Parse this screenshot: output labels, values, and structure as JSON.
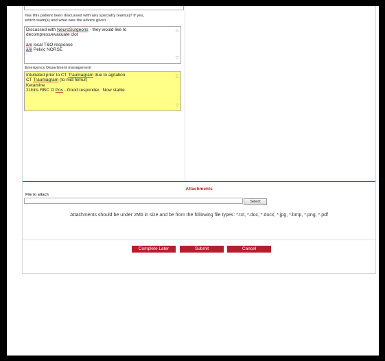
{
  "questions": {
    "specialty_label_1": "Has this patient been discussed with any specialty team(s)? If yes,",
    "specialty_label_2": "which team(s) and what was the advice given",
    "specialty_lines": [
      [
        "Discussed with ",
        "NeuroSurgeons",
        " - they would like to"
      ],
      [
        "decompress/evacuate clot",
        "",
        ""
      ],
      [
        "",
        "",
        ""
      ],
      [
        "",
        "a/e",
        " local T&O response"
      ],
      [
        "",
        "a/e",
        " Pelvic NORSE"
      ]
    ],
    "ed_label": "Emergency Department management",
    "ed_lines": [
      [
        "Intubated prior to CT ",
        "Traumagram",
        " due to agitation"
      ],
      [
        "CT ",
        "Traumagram",
        " (to mid femur)"
      ],
      [
        "Ketamine",
        "",
        ""
      ],
      [
        "2Units RBC O ",
        "Pos",
        " - Good responder.  Now stable"
      ]
    ]
  },
  "attachments": {
    "heading": "Attachments",
    "file_label": "File to attach",
    "select_label": "Select",
    "hint": "Attachments should be under 2Mb in size and be from the following file types: *.txt, *.doc, *.docx, *.jpg, *.bmp, *.png, *.pdf"
  },
  "actions": {
    "complete_later": "Complete Later",
    "submit": "Submit",
    "cancel": "Cancel"
  },
  "icons": {
    "scroll_up": "scroll-up-arrow",
    "scroll_down": "scroll-down-arrow"
  },
  "colors": {
    "accent": "#b81d2b",
    "highlight": "#ffff88"
  }
}
